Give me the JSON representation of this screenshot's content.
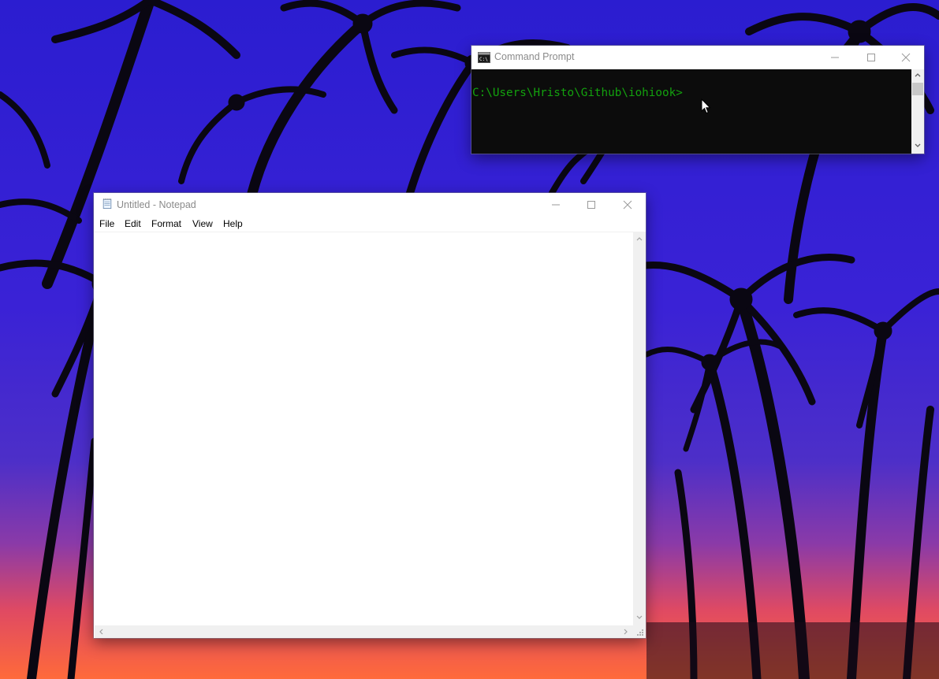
{
  "desktop": {
    "wallpaper": "palm-trees-sunset",
    "sky_top_color": "#2b1dd0",
    "sky_bottom_color": "#ff5a3a"
  },
  "cmd_window": {
    "title": "Command Prompt",
    "icon": "cmd-icon",
    "prompt_text": "C:\\Users\\Hristo\\Github\\iohiook>",
    "prompt_color": "#13a10e",
    "background_color": "#0c0c0c",
    "controls": [
      "minimize-icon",
      "maximize-icon",
      "close-icon"
    ]
  },
  "notepad_window": {
    "title": "Untitled - Notepad",
    "icon": "notepad-icon",
    "menu": [
      "File",
      "Edit",
      "Format",
      "View",
      "Help"
    ],
    "content": "",
    "controls": [
      "minimize-icon",
      "maximize-icon",
      "close-icon"
    ]
  },
  "mouse": {
    "icon": "mouse-pointer-icon"
  }
}
